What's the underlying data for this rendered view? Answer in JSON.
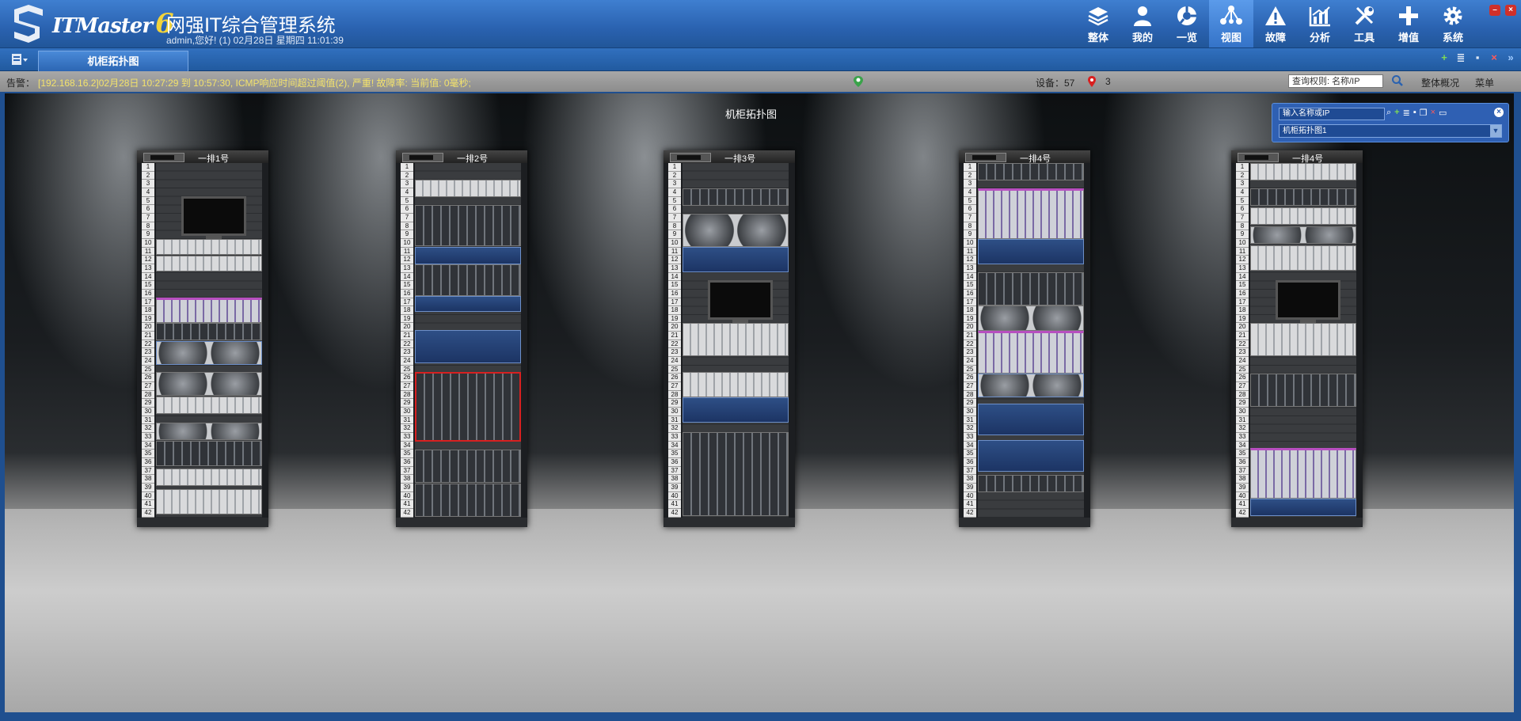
{
  "header": {
    "brand": "ITMaster",
    "brand_version": "6",
    "system_name": "网强IT综合管理系统",
    "greeting": "admin,您好! (1) 02月28日 星期四 11:01:39"
  },
  "nav": [
    {
      "label": "整体",
      "icon": "layers-icon"
    },
    {
      "label": "我的",
      "icon": "user-icon"
    },
    {
      "label": "一览",
      "icon": "overview-icon"
    },
    {
      "label": "视图",
      "icon": "topology-icon",
      "active": true
    },
    {
      "label": "故障",
      "icon": "warning-icon"
    },
    {
      "label": "分析",
      "icon": "chart-icon"
    },
    {
      "label": "工具",
      "icon": "tools-icon"
    },
    {
      "label": "增值",
      "icon": "plus-icon"
    },
    {
      "label": "系统",
      "icon": "gear-icon"
    }
  ],
  "tab": {
    "label": "机柜拓扑图"
  },
  "alarm": {
    "label": "告警：",
    "text": "[192.168.16.2]02月28日 10:27:29 到 10:57:30, ICMP响应时间超过阈值(2), 严重! 故障率: 当前值: 0毫秒;",
    "device_count": "设备：57",
    "alarm_count": "3",
    "query_placeholder": "查询权则: 名称/IP",
    "overview": "整体概况",
    "menu": "菜单"
  },
  "stage": {
    "title": "机柜拓扑图"
  },
  "rack_panel": {
    "search_placeholder": "输入名称或IP",
    "selected": "机柜拓扑图1"
  },
  "racks": [
    {
      "name": "一排1号"
    },
    {
      "name": "一排2号"
    },
    {
      "name": "一排3号"
    },
    {
      "name": "一排4号"
    },
    {
      "name": "一排4号"
    }
  ],
  "colors": {
    "header": "#2a62b0",
    "alarm_text": "#f3e26b",
    "alarm_border": "#d82020"
  }
}
